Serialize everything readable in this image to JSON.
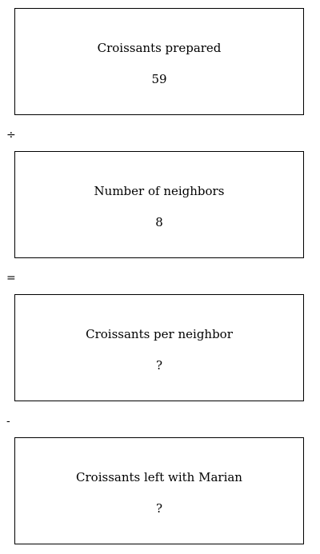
{
  "boxes": [
    {
      "label": "Croissants prepared",
      "value": "59"
    },
    {
      "label": "Number of neighbors",
      "value": "8"
    },
    {
      "label": "Croissants per neighbor",
      "value": "?"
    },
    {
      "label": "Croissants left with Marian",
      "value": "?"
    }
  ],
  "operators": [
    "÷",
    "=",
    "-"
  ]
}
